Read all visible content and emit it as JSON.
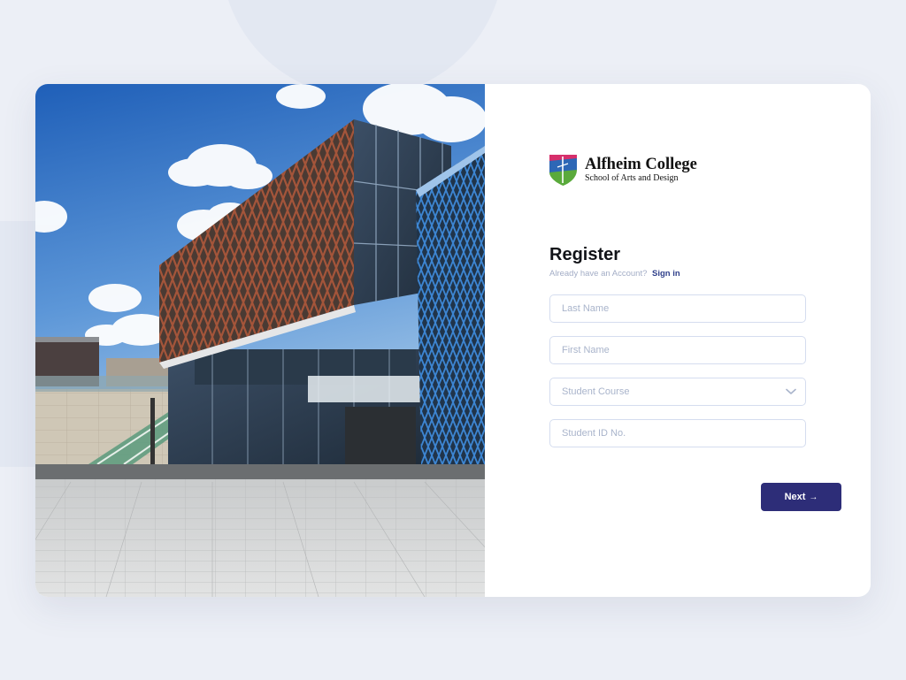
{
  "brand": {
    "name": "Alfheim College",
    "subtitle": "School of Arts and Design",
    "colors": {
      "magenta": "#d62f6b",
      "blue": "#2d67b6",
      "green": "#5aaa3b",
      "accent": "#2d2d78"
    }
  },
  "form": {
    "title": "Register",
    "prompt": "Already have an Account?",
    "signin_label": "Sign in",
    "fields": [
      {
        "name": "last-name",
        "placeholder": "Last Name",
        "value": ""
      },
      {
        "name": "first-name",
        "placeholder": "First Name",
        "value": ""
      },
      {
        "name": "student-course",
        "placeholder": "Student Course",
        "value": "",
        "type": "select"
      },
      {
        "name": "student-id",
        "placeholder": "Student ID No.",
        "value": ""
      }
    ],
    "next_label": "Next",
    "next_icon": "arrow-right-icon"
  }
}
